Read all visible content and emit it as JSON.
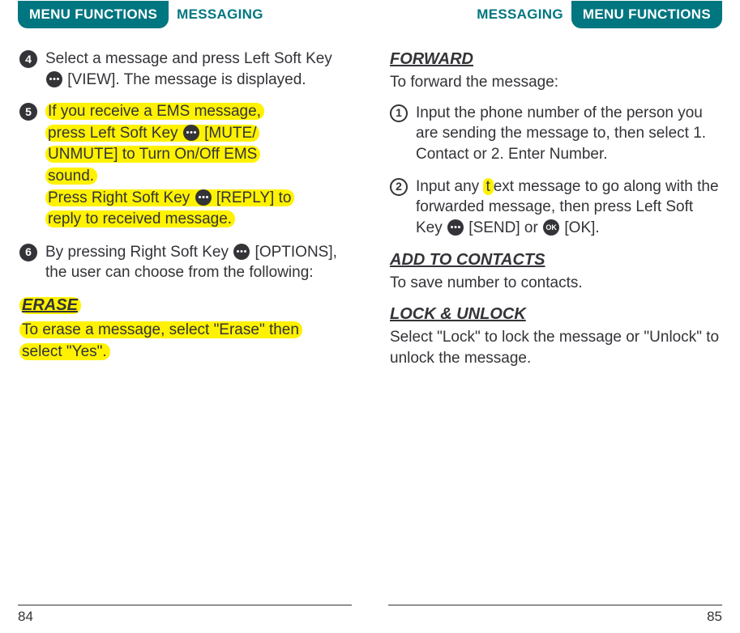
{
  "left": {
    "tab": "MENU FUNCTIONS",
    "section": "MESSAGING",
    "step4": {
      "num": "4",
      "p1a": "Select a message and press Left Soft Key ",
      "p1b": " [VIEW]. The message is displayed."
    },
    "step5": {
      "num": "5",
      "h1a": "If you receive a EMS message,",
      "h1b": "press Left Soft Key ",
      "h1c": " [MUTE/",
      "h1d": "UNMUTE] to Turn On/Off EMS",
      "h1e": "sound.",
      "h2a": "Press Right Soft Key ",
      "h2b": " [REPLY] to",
      "h2c": "reply to received message."
    },
    "step6": {
      "num": "6",
      "p1a": "By pressing Right Soft Key ",
      "p1b": " [OPTIONS], the user can choose from the following:"
    },
    "erase": {
      "heading": "ERASE",
      "l1": "To erase a message, select \"Erase\" then",
      "l2": "select \"Yes\"."
    },
    "pageNum": "84"
  },
  "right": {
    "section": "MESSAGING",
    "tab": "MENU FUNCTIONS",
    "forward": {
      "heading": "FORWARD",
      "sub": "To forward the message:",
      "s1": {
        "num": "1",
        "text": "Input the phone number of the person you are sending the message to, then select 1. Contact or 2. Enter Number."
      },
      "s2": {
        "num": "2",
        "a": "Input any ",
        "hl": "t",
        "b": "ext message to go along with the forwarded message, then press Left Soft Key ",
        "c": " [SEND] or ",
        "d": " [OK]."
      }
    },
    "addContacts": {
      "heading": "ADD TO CONTACTS",
      "sub": "To save number to contacts."
    },
    "lockUnlock": {
      "heading": "LOCK & UNLOCK",
      "sub": "Select \"Lock\" to lock the message or \"Unlock\" to unlock the message."
    },
    "pageNum": "85"
  }
}
